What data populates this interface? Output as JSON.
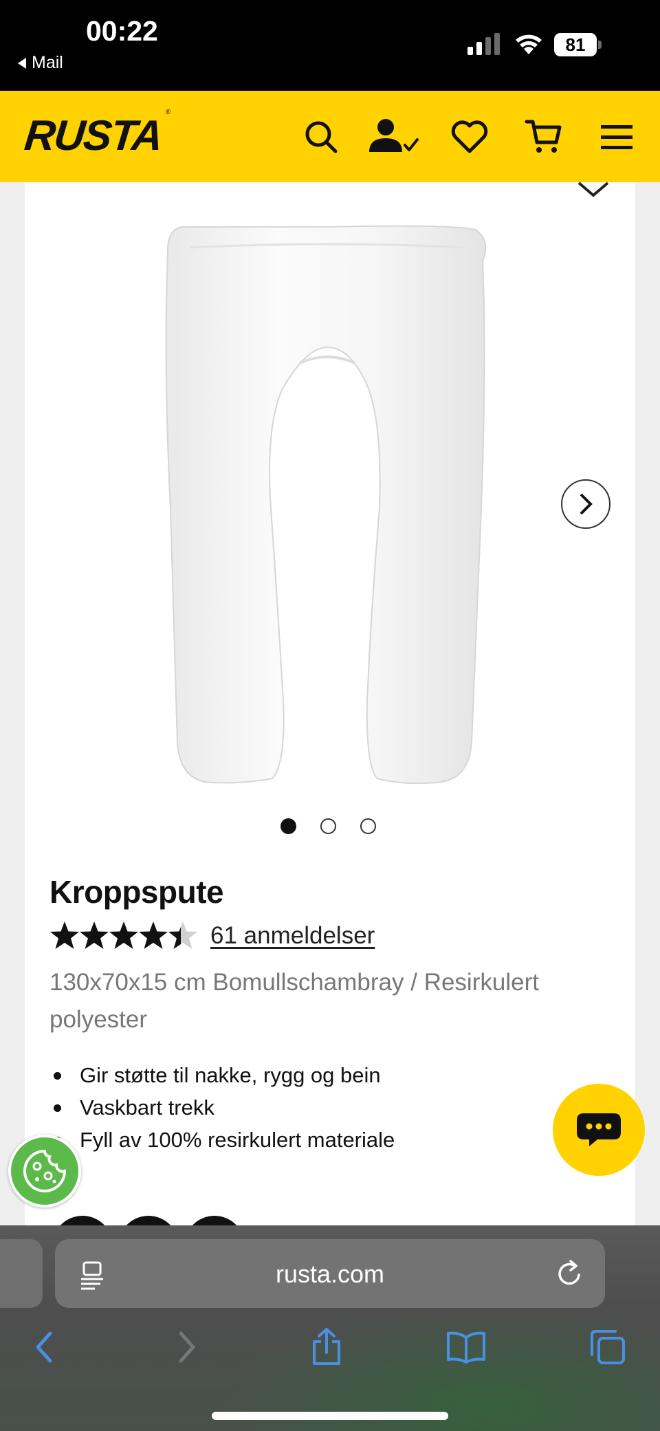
{
  "status_bar": {
    "time": "00:22",
    "back_label": "Mail",
    "battery": "81"
  },
  "header": {
    "logo": "RUSTA",
    "logo_mark": "®",
    "icons": [
      "search-icon",
      "account-icon",
      "heart-icon",
      "cart-icon",
      "menu-icon"
    ],
    "brand_color": "#ffd200"
  },
  "gallery": {
    "image": "u-shaped-body-pillow",
    "slides": 3,
    "active_slide": 1
  },
  "product": {
    "title": "Kroppspute",
    "rating": 4.5,
    "reviews_label": "61 anmeldelser",
    "description": "130x70x15 cm Bomullschambray / Resirkulert polyester",
    "features": [
      "Gir støtte til nakke, rygg og bein",
      "Vaskbart trekk",
      "Fyll av 100% resirkulert materiale"
    ]
  },
  "floating": {
    "chat": "chat-icon",
    "cookie": "cookie-icon",
    "cookie_color": "#5cba4a"
  },
  "safari": {
    "url": "rusta.com",
    "buttons": [
      "back-icon",
      "forward-icon",
      "share-icon",
      "bookmarks-icon",
      "tabs-icon"
    ],
    "accent": "#4a90e2"
  }
}
